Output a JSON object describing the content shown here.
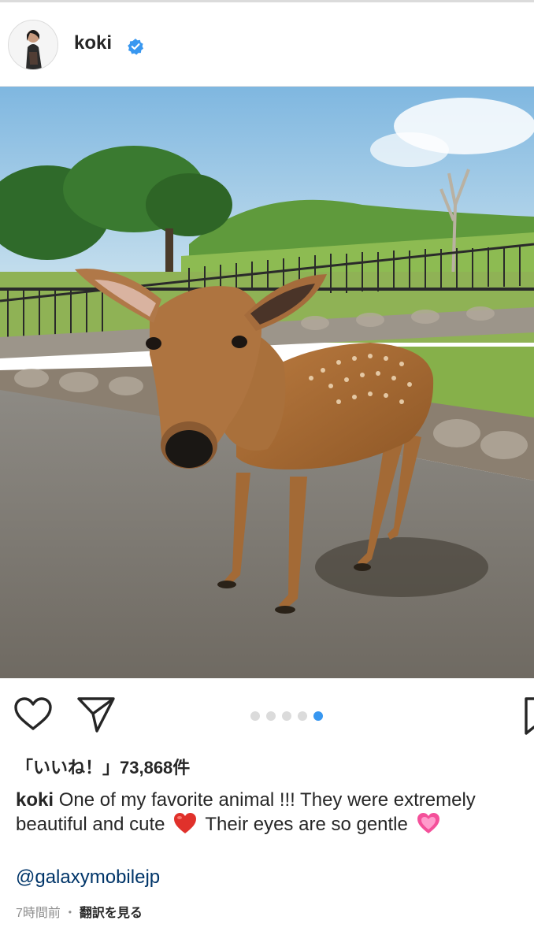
{
  "post": {
    "username": "koki",
    "verified_icon": "verified-badge-icon",
    "likes_text": "「いいね！」73,868件",
    "caption": {
      "username": "koki",
      "text_part1": "One of my favorite animal !!! They were extremely beautiful and cute",
      "emoji1": "red-heart-emoji",
      "text_part2": "Their eyes are so gentle",
      "emoji2": "pink-heart-emoji"
    },
    "mention": "@galaxymobilejp",
    "timestamp": "7時間前",
    "separator": "・",
    "translate_label": "翻訳を見る"
  },
  "carousel": {
    "count": 5,
    "active_index": 5
  },
  "icons": {
    "like": "heart-outline-icon",
    "share": "paper-plane-icon",
    "save": "bookmark-icon"
  },
  "colors": {
    "accent": "#3897f0",
    "text": "#262626",
    "muted": "#8e8e8e",
    "link": "#003569",
    "dot_inactive": "#dbdbdb"
  }
}
